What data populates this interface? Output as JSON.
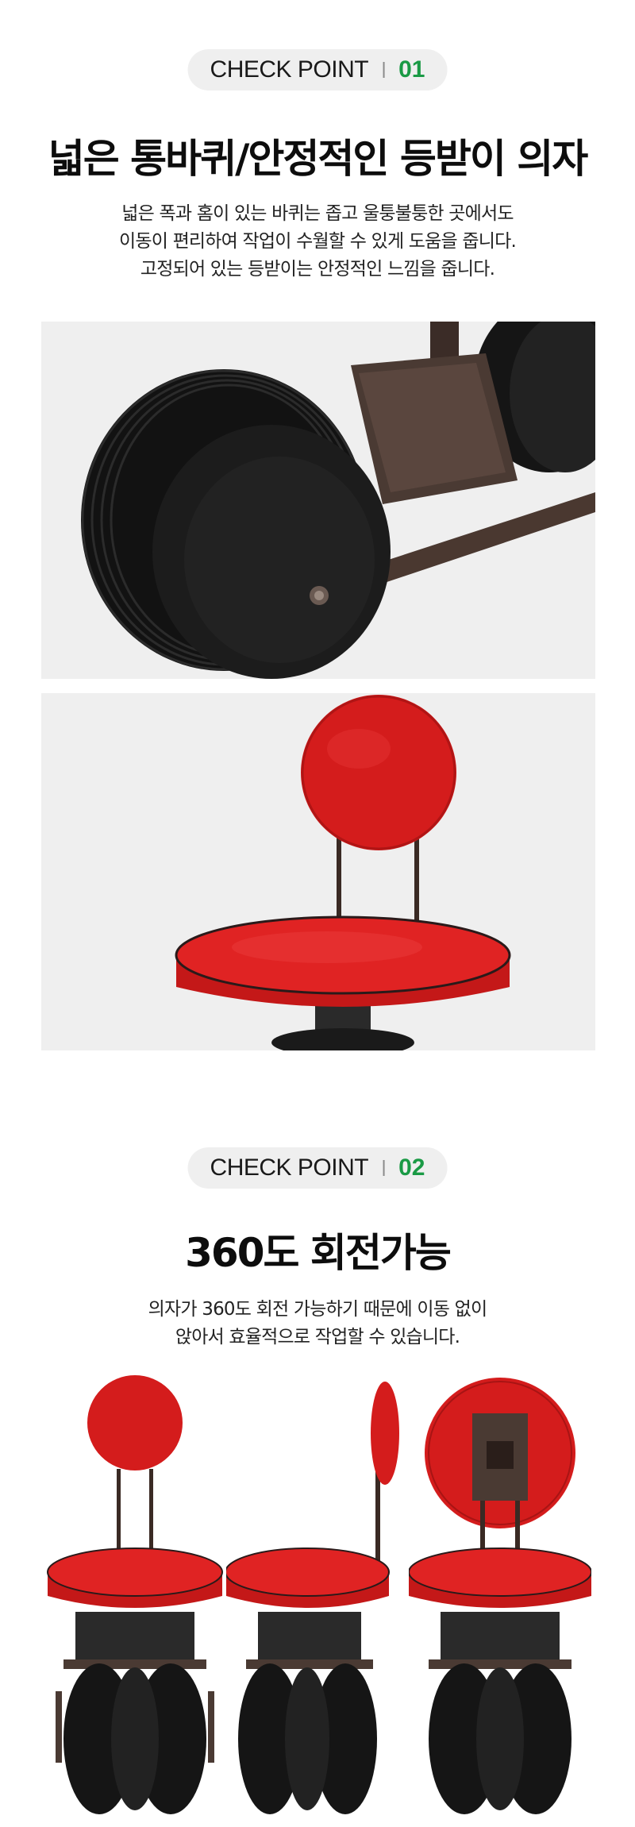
{
  "point1": {
    "badge_label": "CHECK POINT",
    "badge_number": "01",
    "title": "넓은 통바퀴/안정적인 등받이 의자",
    "lines": [
      "넓은 폭과 홈이 있는 바퀴는 좁고 울퉁불퉁한 곳에서도",
      "이동이 편리하여 작업이 수월할 수 있게 도움을 줍니다.",
      "고정되어 있는 등받이는 안정적인 느낌을 줍니다."
    ]
  },
  "point2": {
    "badge_label": "CHECK POINT",
    "badge_number": "02",
    "title": "360도 회전가능",
    "lines": [
      "의자가 360도 회전 가능하기 때문에 이동 없이",
      "앉아서 효율적으로 작업할 수 있습니다."
    ]
  },
  "colors": {
    "accent_green": "#1a9a45",
    "seat_red": "#d91f1f",
    "frame_brown": "#4a3a33",
    "wheel_black": "#1a1a1a",
    "photo_bg": "#efefef"
  }
}
